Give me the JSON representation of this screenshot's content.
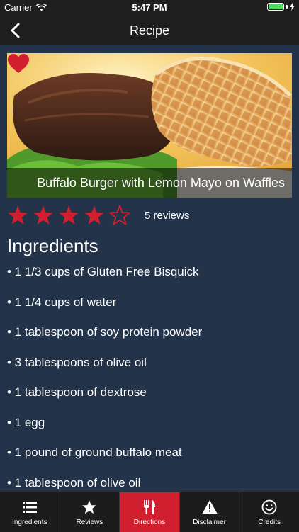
{
  "status": {
    "carrier": "Carrier",
    "time": "5:47 PM"
  },
  "nav": {
    "title": "Recipe"
  },
  "recipe": {
    "title": "Buffalo Burger with Lemon Mayo on Waffles",
    "rating": 4,
    "rating_max": 5,
    "reviews_label": "5 reviews",
    "favorited": true
  },
  "ingredients_heading": "Ingredients",
  "ingredients": [
    "• 1 1/3 cups of Gluten Free Bisquick",
    "• 1 1/4 cups of water",
    "• 1 tablespoon of soy protein powder",
    "• 3 tablespoons of olive oil",
    "• 1 tablespoon of dextrose",
    "• 1 egg",
    "• 1 pound of ground buffalo meat",
    "• 1 tablespoon of olive oil"
  ],
  "tabs": [
    {
      "label": "Ingredients",
      "icon": "list-icon",
      "active": false
    },
    {
      "label": "Reviews",
      "icon": "star-icon",
      "active": false
    },
    {
      "label": "Directions",
      "icon": "fork-knife-icon",
      "active": true
    },
    {
      "label": "Disclaimer",
      "icon": "warning-icon",
      "active": false
    },
    {
      "label": "Credits",
      "icon": "smiley-icon",
      "active": false
    }
  ],
  "colors": {
    "accent": "#d01f2e",
    "background": "#23334a",
    "bar": "#1e1e1e",
    "battery": "#4cd964"
  }
}
